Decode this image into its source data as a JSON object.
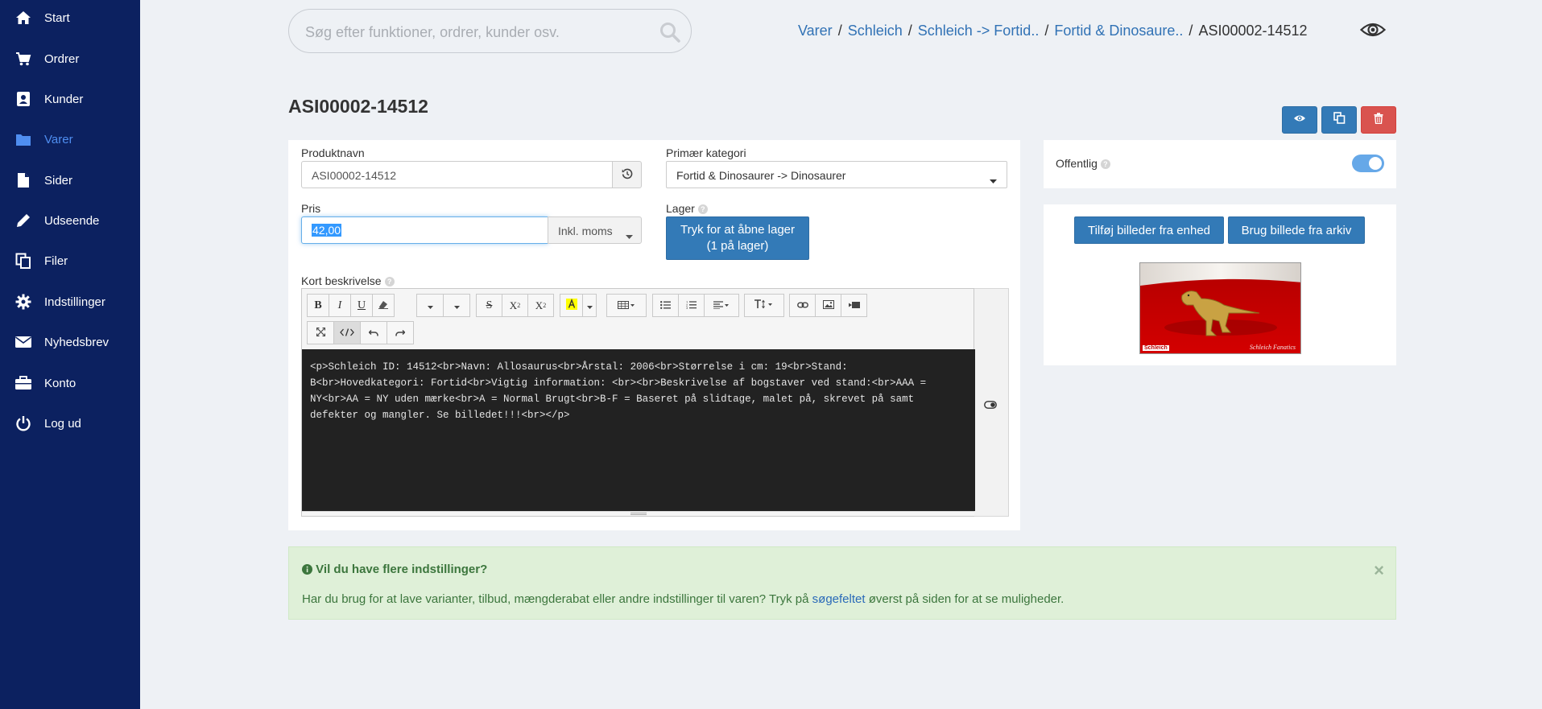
{
  "sidebar": {
    "items": [
      {
        "label": "Start",
        "icon": "home-icon"
      },
      {
        "label": "Ordrer",
        "icon": "cart-icon"
      },
      {
        "label": "Kunder",
        "icon": "contact-icon"
      },
      {
        "label": "Varer",
        "icon": "folder-icon",
        "active": true
      },
      {
        "label": "Sider",
        "icon": "file-icon"
      },
      {
        "label": "Udseende",
        "icon": "pencil-icon"
      },
      {
        "label": "Filer",
        "icon": "copy-icon"
      },
      {
        "label": "Indstillinger",
        "icon": "gear-icon"
      },
      {
        "label": "Nyhedsbrev",
        "icon": "envelope-icon"
      },
      {
        "label": "Konto",
        "icon": "briefcase-icon"
      },
      {
        "label": "Log ud",
        "icon": "power-icon"
      }
    ]
  },
  "search": {
    "placeholder": "Søg efter funktioner, ordrer, kunder osv."
  },
  "breadcrumb": {
    "links": [
      "Varer",
      "Schleich",
      "Schleich -> Fortid..",
      "Fortid & Dinosaure.."
    ],
    "current": "ASI00002-14512"
  },
  "page": {
    "title": "ASI00002-14512"
  },
  "form": {
    "name_label": "Produktnavn",
    "name_value": "ASI00002-14512",
    "category_label": "Primær kategori",
    "category_value": "Fortid & Dinosaurer -> Dinosaurer",
    "price_label": "Pris",
    "price_value": "42,00",
    "vat_label": "Inkl. moms",
    "stock_label": "Lager",
    "stock_button_line1": "Tryk for at åbne lager",
    "stock_button_line2": "(1 på lager)",
    "desc_label": "Kort beskrivelse",
    "desc_code": "<p>Schleich ID: 14512<br>Navn: Allosaurus<br>Årstal: 2006<br>Størrelse i cm: 19<br>Stand: B<br>Hovedkategori: Fortid<br>Vigtig information: <br><br>Beskrivelse af bogstaver ved stand:<br>AAA = NY<br>AA = NY uden mærke<br>A = Normal Brugt<br>B-F = Baseret på slidtage, malet på, skrevet på samt defekter og mangler. Se billedet!!!<br></p>"
  },
  "public": {
    "label": "Offentlig",
    "enabled": true
  },
  "images": {
    "add_device": "Tilføj billeder fra enhed",
    "use_archive": "Brug billede fra arkiv",
    "thumb_logo": "Schleich",
    "thumb_caption": "Schleich Fanatics"
  },
  "alert": {
    "title": "Vil du have flere indstillinger?",
    "body_before": "Har du brug for at lave varianter, tilbud, mængderabat eller andre indstillinger til varen? Tryk på ",
    "body_link": "søgefeltet",
    "body_after": " øverst på siden for at se muligheder.",
    "close": "×"
  },
  "colors": {
    "sidebar": "#0c2160",
    "accent": "#337ab7",
    "danger": "#d9534f",
    "active_nav": "#4f8ef0"
  }
}
